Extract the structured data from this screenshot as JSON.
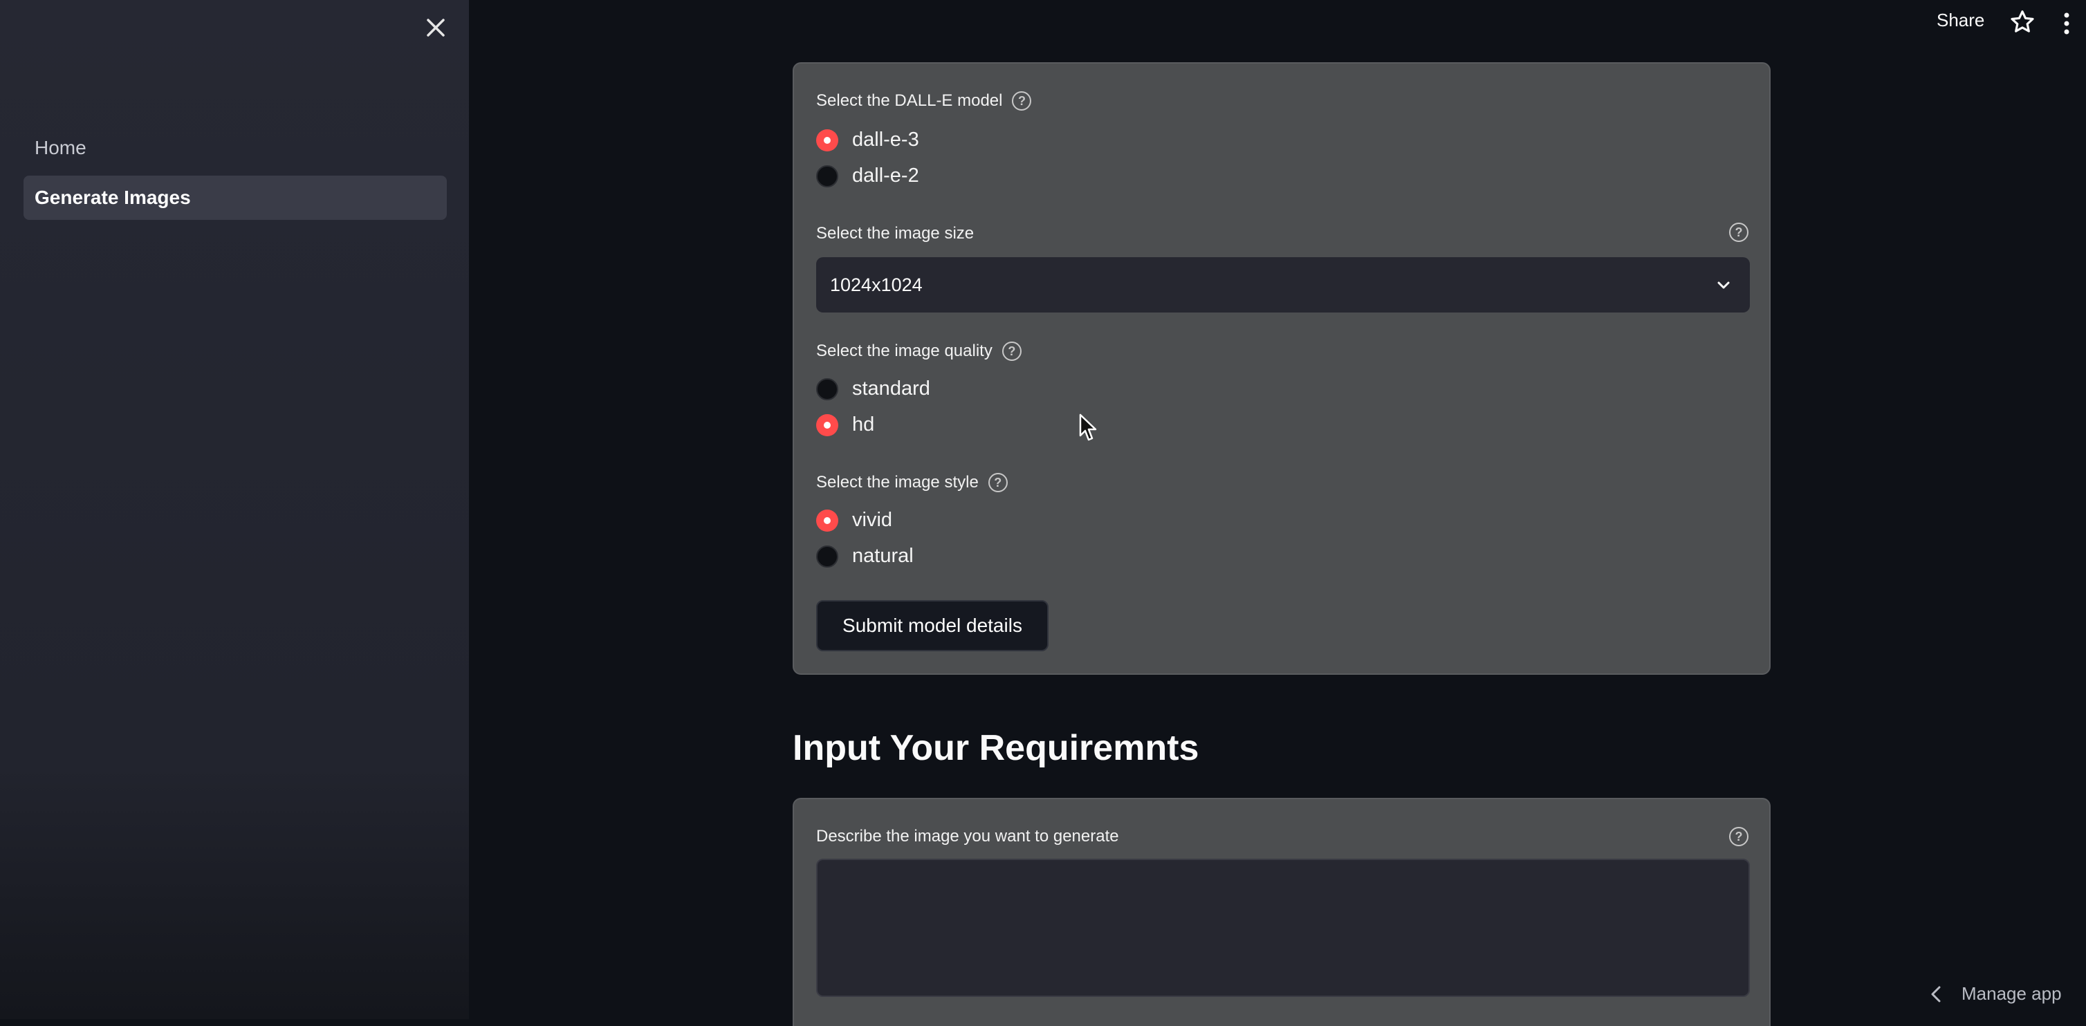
{
  "sidebar": {
    "close_icon": "close-icon",
    "items": [
      {
        "label": "Home",
        "active": false
      },
      {
        "label": "Generate Images",
        "active": true
      }
    ]
  },
  "topbar": {
    "share_label": "Share",
    "star_icon": "star-icon",
    "menu_icon": "kebab-menu-icon"
  },
  "model_form": {
    "model": {
      "label": "Select the DALL-E model",
      "options": [
        {
          "label": "dall-e-3",
          "selected": true
        },
        {
          "label": "dall-e-2",
          "selected": false
        }
      ]
    },
    "size": {
      "label": "Select the image size",
      "value": "1024x1024"
    },
    "quality": {
      "label": "Select the image quality",
      "options": [
        {
          "label": "standard",
          "selected": false
        },
        {
          "label": "hd",
          "selected": true
        }
      ]
    },
    "style": {
      "label": "Select the image style",
      "options": [
        {
          "label": "vivid",
          "selected": true
        },
        {
          "label": "natural",
          "selected": false
        }
      ]
    },
    "submit_label": "Submit model details"
  },
  "requirements": {
    "heading": "Input Your Requiremnts",
    "description_label": "Describe the image you want to generate",
    "description_value": ""
  },
  "footer": {
    "manage_label": "Manage app"
  },
  "colors": {
    "accent": "#ff4b4b",
    "background": "#0e1117",
    "sidebar": "#262833",
    "card": "#4c4e50"
  }
}
